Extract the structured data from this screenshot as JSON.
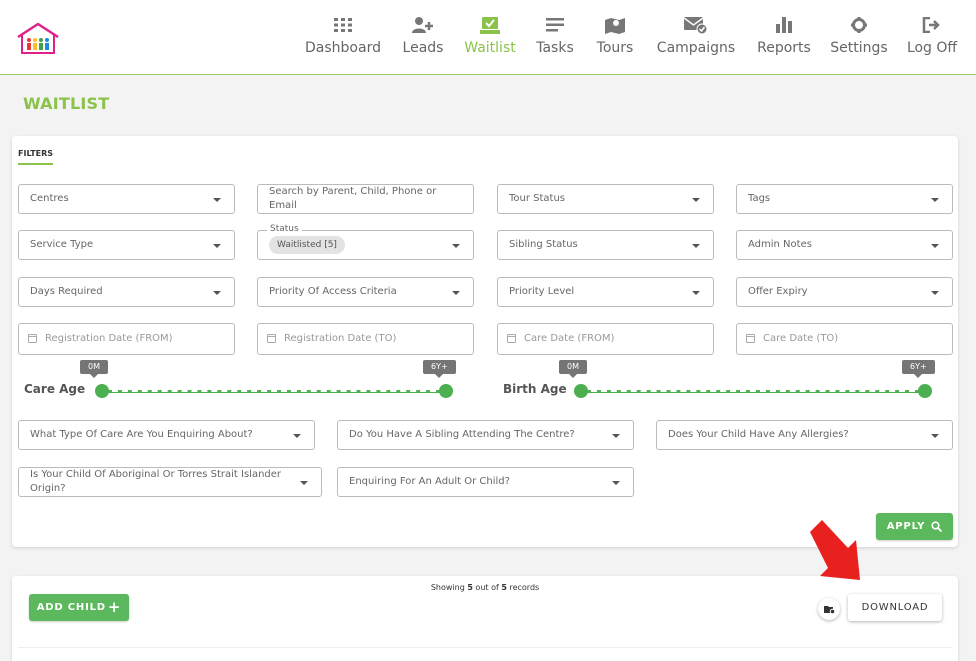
{
  "nav": {
    "items": [
      {
        "label": "Dashboard",
        "icon": "grid-icon"
      },
      {
        "label": "Leads",
        "icon": "add-user-icon"
      },
      {
        "label": "Waitlist",
        "icon": "inbox-check-icon",
        "active": true
      },
      {
        "label": "Tasks",
        "icon": "list-icon"
      },
      {
        "label": "Tours",
        "icon": "map-pin-icon"
      },
      {
        "label": "Campaigns",
        "icon": "mail-check-icon"
      },
      {
        "label": "Reports",
        "icon": "bar-chart-icon"
      },
      {
        "label": "Settings",
        "icon": "gear-icon"
      },
      {
        "label": "Log Off",
        "icon": "logout-icon"
      }
    ]
  },
  "page": {
    "title": "WAITLIST"
  },
  "filters": {
    "tab_label": "FILTERS",
    "centres": "Centres",
    "search_placeholder": "Search by Parent, Child, Phone or Email",
    "tour_status": "Tour Status",
    "tags": "Tags",
    "service_type": "Service Type",
    "status_label": "Status",
    "status_chip": "Waitlisted [5]",
    "sibling_status": "Sibling Status",
    "admin_notes": "Admin Notes",
    "days_required": "Days Required",
    "priority_access": "Priority Of Access Criteria",
    "priority_level": "Priority Level",
    "offer_expiry": "Offer Expiry",
    "reg_from": "Registration Date (FROM)",
    "reg_to": "Registration Date (TO)",
    "care_from": "Care Date (FROM)",
    "care_to": "Care Date (TO)",
    "care_age": {
      "label": "Care Age",
      "min": "0M",
      "max": "6Y+"
    },
    "birth_age": {
      "label": "Birth Age",
      "min": "0M",
      "max": "6Y+"
    },
    "q_care_type": "What Type Of Care Are You Enquiring About?",
    "q_sibling": "Do You Have A Sibling Attending The Centre?",
    "q_allergies": "Does Your Child Have Any Allergies?",
    "q_aboriginal": "Is Your Child Of Aboriginal Or Torres Strait Islander Origin?",
    "q_adult_child": "Enquiring For An Adult Or Child?",
    "apply_label": "APPLY"
  },
  "results": {
    "add_child_label": "ADD CHILD",
    "records_prefix": "Showing ",
    "records_shown": "5",
    "records_middle": " out of ",
    "records_total": "5",
    "records_suffix": " records",
    "download_label": "DOWNLOAD"
  },
  "colors": {
    "accent": "#8bc34a",
    "button_green": "#5cb85c",
    "annotation_arrow": "#e8201e"
  }
}
